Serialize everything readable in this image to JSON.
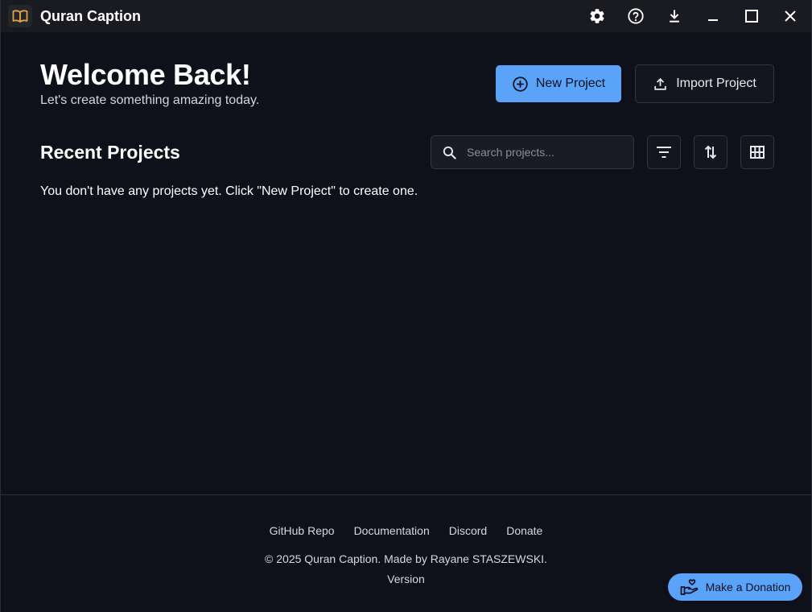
{
  "titlebar": {
    "app_title": "Quran Caption",
    "icons": [
      "book-icon",
      "gear-icon",
      "help-icon",
      "download-icon",
      "minimize-icon",
      "maximize-icon",
      "close-icon"
    ]
  },
  "header": {
    "title": "Welcome Back!",
    "subtitle": "Let's create something amazing today.",
    "new_project_label": "New Project",
    "import_project_label": "Import Project"
  },
  "projects": {
    "section_title": "Recent Projects",
    "search_placeholder": "Search projects...",
    "search_value": "",
    "empty_message": "You don't have any projects yet. Click \"New Project\" to create one."
  },
  "footer": {
    "links": [
      "GitHub Repo",
      "Documentation",
      "Discord",
      "Donate"
    ],
    "copyright": "© 2025 Quran Caption. Made by Rayane STASZEWSKI.",
    "version": "Version",
    "donate_button": "Make a Donation"
  },
  "colors": {
    "accent": "#5aa3f8",
    "background": "#0e111a",
    "titlebar": "#191b21",
    "logo_gold": "#e3a33a"
  }
}
